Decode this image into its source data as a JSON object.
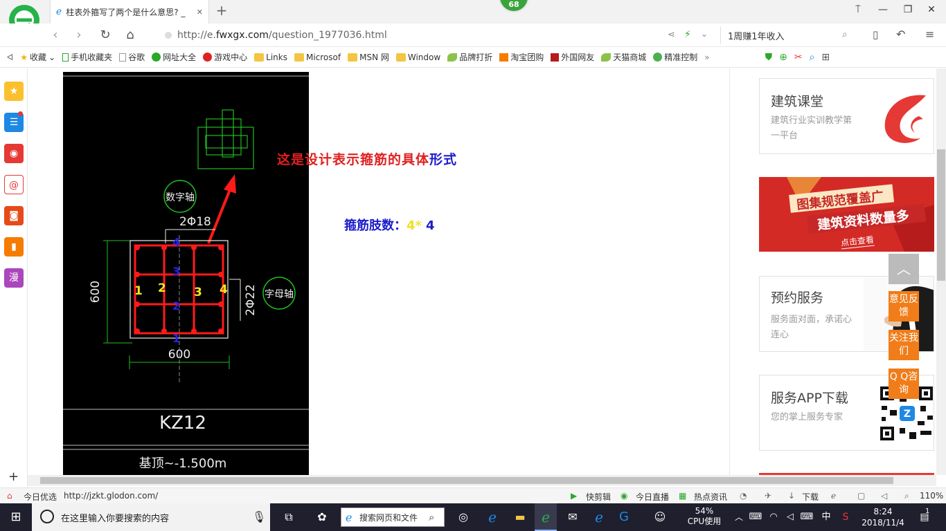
{
  "tab": {
    "title": "柱表外箍写了两个是什么意思? _",
    "close": "✕",
    "new": "+"
  },
  "badge": "68",
  "window": {
    "pin": "⍑",
    "min": "—",
    "max": "❐",
    "close": "✕"
  },
  "address": {
    "url_prefix": "http://e.",
    "url_domain": "fwxgx.com",
    "url_path": "/question_1977036.html",
    "search_text": "1周赚1年收入"
  },
  "bookmarks": [
    "收藏",
    "手机收藏夹",
    "谷歌",
    "网址大全",
    "游戏中心",
    "Links",
    "Microsof",
    "MSN 网",
    "Window",
    "品牌打折",
    "淘宝团购",
    "外国网友",
    "天猫商城",
    "精准控制"
  ],
  "cad": {
    "dim_top": "2Φ18",
    "dim_side": "2Φ22",
    "dim_left": "600",
    "dim_bottom": "600",
    "bubble1": "数字轴",
    "bubble2": "字母轴",
    "yellow": [
      "1",
      "2",
      "3",
      "4"
    ],
    "blue": [
      "4",
      "3",
      "2",
      "1"
    ],
    "name": "KZ12",
    "level": "基顶~-1.500m"
  },
  "annotation1": {
    "red": "这是设计表示箍筋的具体",
    "blue": "形式"
  },
  "annotation2": {
    "label": "箍筋肢数：",
    "v1": "4",
    "star": "*",
    "v2": "4"
  },
  "cards": [
    {
      "title": "建筑课堂",
      "sub": "建筑行业实训教学第一平台"
    },
    {
      "title": "预约服务",
      "sub": "服务面对面，承诺心连心"
    },
    {
      "title": "服务APP下载",
      "sub": "您的掌上服务专家"
    }
  ],
  "banner": {
    "line1": "图集规范覆盖广",
    "line2": "建筑资料数量多",
    "cta": "点击查看"
  },
  "float": {
    "top": "︿",
    "feedback": "意见反馈",
    "follow": "关注我们",
    "qq": "Q Q咨询"
  },
  "status": {
    "left_label": "今日优选",
    "url": "http://jzkt.glodon.com/",
    "items": [
      "快剪辑",
      "今日直播",
      "热点资讯",
      "下载"
    ],
    "zoom": "110%"
  },
  "taskbar": {
    "search": "在这里输入你要搜索的内容",
    "search2": "搜索网页和文件",
    "cpu_pct": "54%",
    "cpu_label": "CPU使用",
    "ime": "中",
    "time": "8:24",
    "date": "2018/11/4",
    "notif": "1"
  },
  "colors": {
    "accent": "#3ba33b",
    "red": "#e02020",
    "blue": "#1c1ccc",
    "orange": "#f07d19"
  }
}
